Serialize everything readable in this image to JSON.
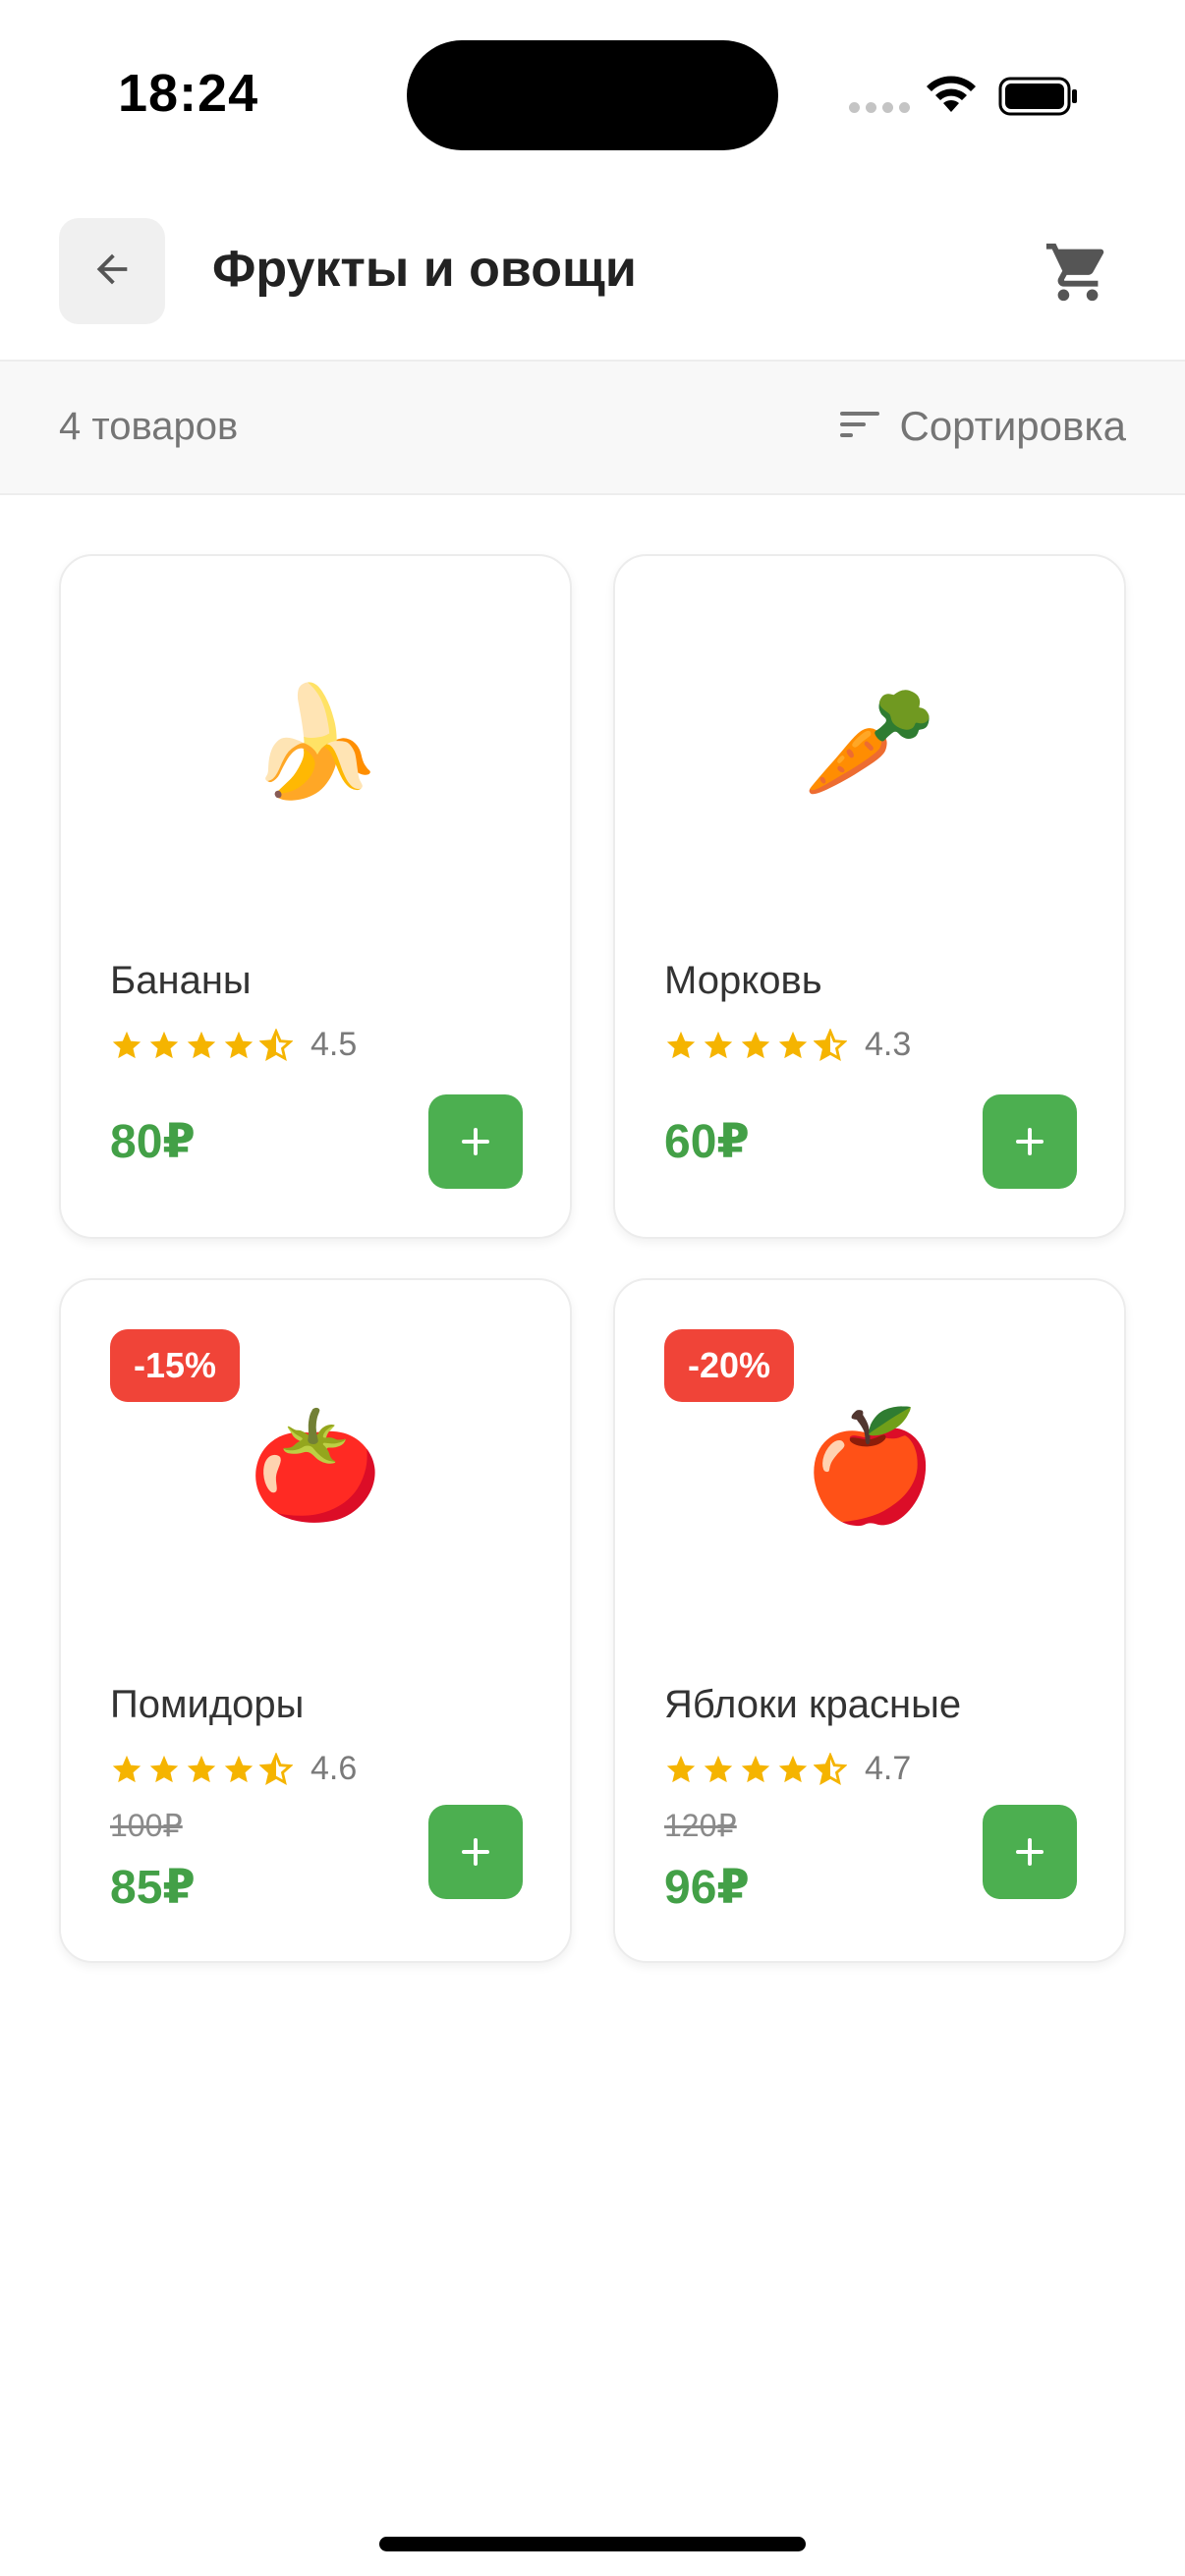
{
  "status_bar": {
    "time": "18:24"
  },
  "header": {
    "title": "Фрукты и овощи"
  },
  "toolbar": {
    "count_label": "4 товаров",
    "sort_label": "Сортировка"
  },
  "products": [
    {
      "name": "Бананы",
      "rating": "4.5",
      "price": "80₽",
      "old_price": "",
      "discount": "",
      "emoji": "🍌"
    },
    {
      "name": "Морковь",
      "rating": "4.3",
      "price": "60₽",
      "old_price": "",
      "discount": "",
      "emoji": "🥕"
    },
    {
      "name": "Помидоры",
      "rating": "4.6",
      "price": "85₽",
      "old_price": "100₽",
      "discount": "-15%",
      "emoji": "🍅"
    },
    {
      "name": "Яблоки красные",
      "rating": "4.7",
      "price": "96₽",
      "old_price": "120₽",
      "discount": "-20%",
      "emoji": "🍎"
    }
  ],
  "icons": {
    "back": "arrow-left-icon",
    "cart": "cart-icon",
    "sort": "sort-icon",
    "add": "plus-icon",
    "star": "star-icon"
  },
  "colors": {
    "accent": "#4caf50",
    "price": "#43a047",
    "discount": "#f04438",
    "star": "#f5b400"
  }
}
